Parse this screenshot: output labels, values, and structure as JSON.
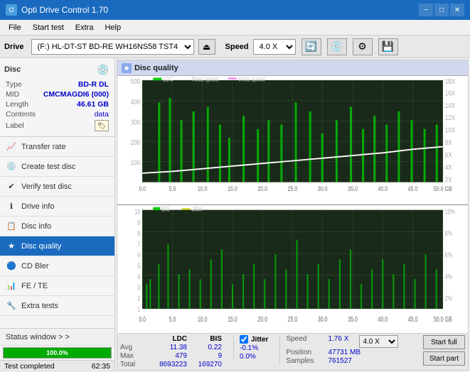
{
  "titlebar": {
    "title": "Opti Drive Control 1.70",
    "icon": "O",
    "minimize": "−",
    "maximize": "□",
    "close": "✕"
  },
  "menubar": {
    "items": [
      "File",
      "Start test",
      "Extra",
      "Help"
    ]
  },
  "drivebar": {
    "drive_label": "Drive",
    "drive_value": "(F:)  HL-DT-ST BD-RE  WH16NS58 TST4",
    "speed_label": "Speed",
    "speed_value": "4.0 X"
  },
  "disc": {
    "title": "Disc",
    "type_label": "Type",
    "type_value": "BD-R DL",
    "mid_label": "MID",
    "mid_value": "CMCMAGDI6 (000)",
    "length_label": "Length",
    "length_value": "46.61 GB",
    "contents_label": "Contents",
    "contents_value": "data",
    "label_label": "Label"
  },
  "nav": {
    "items": [
      {
        "id": "transfer-rate",
        "label": "Transfer rate",
        "icon": "📈"
      },
      {
        "id": "create-test-disc",
        "label": "Create test disc",
        "icon": "💿"
      },
      {
        "id": "verify-test-disc",
        "label": "Verify test disc",
        "icon": "✔"
      },
      {
        "id": "drive-info",
        "label": "Drive info",
        "icon": "ℹ"
      },
      {
        "id": "disc-info",
        "label": "Disc info",
        "icon": "📋"
      },
      {
        "id": "disc-quality",
        "label": "Disc quality",
        "icon": "★",
        "active": true
      },
      {
        "id": "cd-bler",
        "label": "CD Bler",
        "icon": "🔵"
      },
      {
        "id": "fe-te",
        "label": "FE / TE",
        "icon": "📊"
      },
      {
        "id": "extra-tests",
        "label": "Extra tests",
        "icon": "🔧"
      }
    ]
  },
  "status_window": {
    "label": "Status window > >"
  },
  "progress": {
    "percent": 100,
    "label": "100.0%"
  },
  "status_bar": {
    "left": "Test completed",
    "right": "62:35"
  },
  "chart": {
    "title": "Disc quality",
    "legend_top": [
      "LDC",
      "Read speed",
      "Write speed"
    ],
    "legend_bottom": [
      "BIS",
      "Jitter"
    ],
    "top_y_max": 500,
    "top_y_labels": [
      "500",
      "400",
      "300",
      "200",
      "100"
    ],
    "top_y2_labels": [
      "18X",
      "16X",
      "14X",
      "12X",
      "10X",
      "8X",
      "6X",
      "4X",
      "2X"
    ],
    "bottom_y_max": 10,
    "bottom_y_labels": [
      "10",
      "9",
      "8",
      "7",
      "6",
      "5",
      "4",
      "3",
      "2",
      "1"
    ],
    "bottom_y2_labels": [
      "10%",
      "8%",
      "6%",
      "4%",
      "2%"
    ],
    "x_labels": [
      "0.0",
      "5.0",
      "10.0",
      "15.0",
      "20.0",
      "25.0",
      "30.0",
      "35.0",
      "40.0",
      "45.0",
      "50.0 GB"
    ]
  },
  "stats": {
    "ldc_label": "LDC",
    "bis_label": "BIS",
    "jitter_label": "Jitter",
    "avg_label": "Avg",
    "avg_ldc": "11.38",
    "avg_bis": "0.22",
    "avg_jitter": "-0.1%",
    "max_label": "Max",
    "max_ldc": "479",
    "max_bis": "9",
    "max_jitter": "0.0%",
    "total_label": "Total",
    "total_ldc": "8693223",
    "total_bis": "169270",
    "speed_label": "Speed",
    "speed_value": "1.76 X",
    "speed_select": "4.0 X",
    "position_label": "Position",
    "position_value": "47731 MB",
    "samples_label": "Samples",
    "samples_value": "761527",
    "start_full_btn": "Start full",
    "start_part_btn": "Start part"
  }
}
